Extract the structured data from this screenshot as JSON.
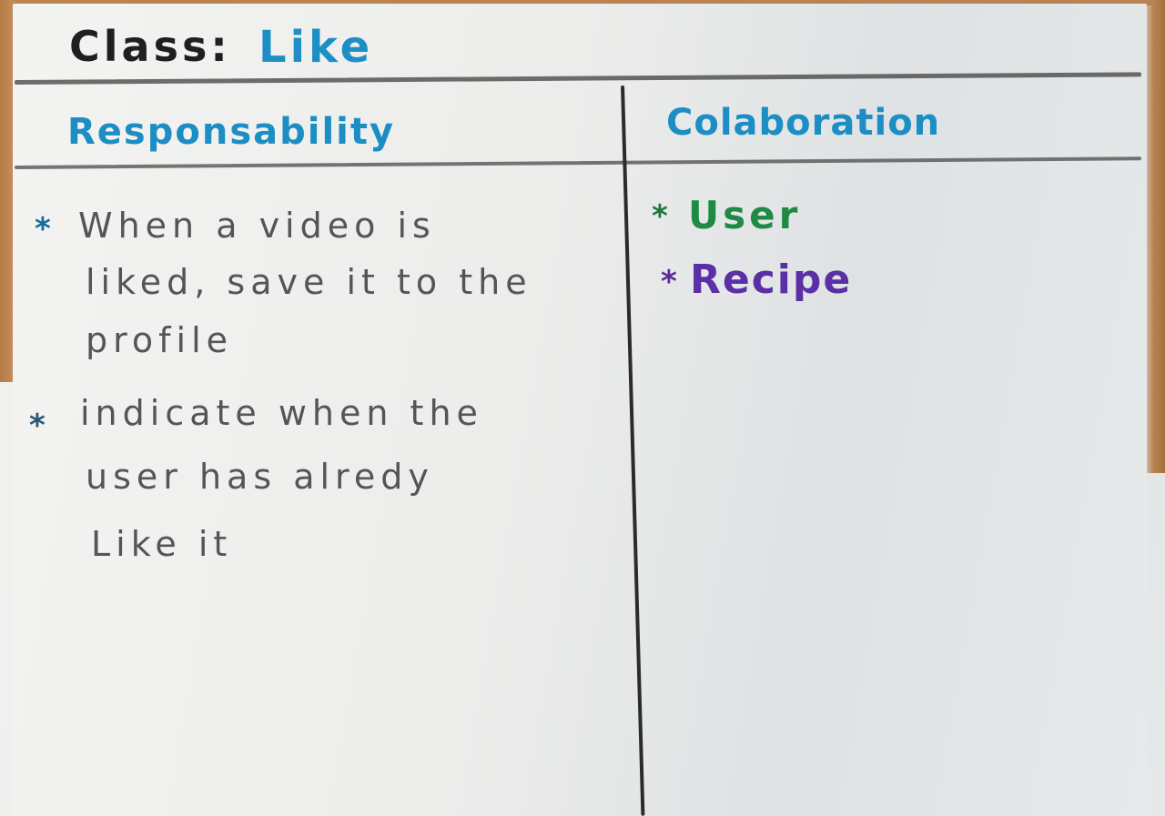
{
  "card": {
    "class_label": "Class:",
    "class_name": "Like",
    "responsibility_header": "Responsability",
    "collaboration_header": "Colaboration",
    "responsibilities": {
      "item1_line1": "When a video is",
      "item1_line2": "liked, save it to the",
      "item1_line3": "profile",
      "item2_line1": "indicate when the",
      "item2_line2": "user has alredy",
      "item2_line3": "Like it"
    },
    "collaborators": {
      "user": "User",
      "recipe": "Recipe"
    },
    "bullet_glyph": "*",
    "colors": {
      "header_blue": "#1c8ec4",
      "user_green": "#1e8a45",
      "recipe_purple": "#5b2fa6",
      "pencil_gray": "#555555"
    }
  }
}
